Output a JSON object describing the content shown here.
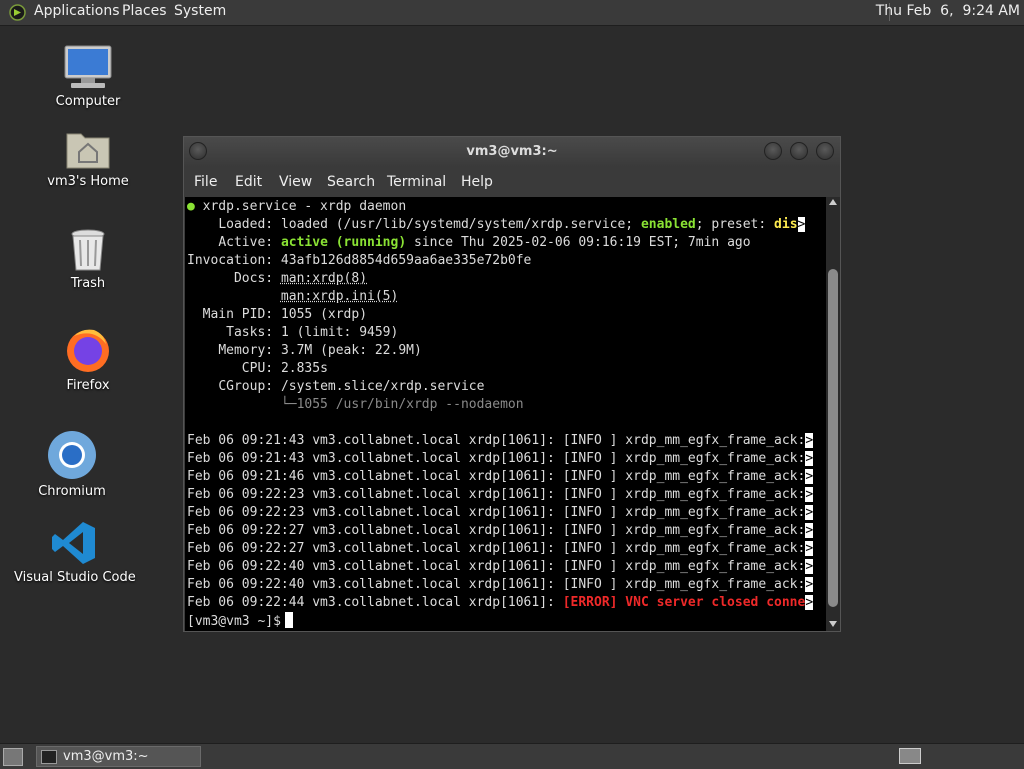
{
  "top_panel": {
    "menus": [
      "Applications",
      "Places",
      "System"
    ],
    "clock": "Thu Feb  6,  9:24 AM"
  },
  "desktop_icons": [
    {
      "label": "Computer",
      "icon": "computer-icon"
    },
    {
      "label": "vm3's Home",
      "icon": "home-folder-icon"
    },
    {
      "label": "Trash",
      "icon": "trash-icon"
    },
    {
      "label": "Firefox",
      "icon": "firefox-icon"
    },
    {
      "label": "Chromium",
      "icon": "chromium-icon"
    },
    {
      "label": "Visual Studio Code",
      "icon": "vscode-icon"
    }
  ],
  "terminal": {
    "title": "vm3@vm3:~",
    "menu": [
      "File",
      "Edit",
      "View",
      "Search",
      "Terminal",
      "Help"
    ],
    "status": {
      "header_unit": "xrdp.service - xrdp daemon",
      "loaded_label": "Loaded:",
      "loaded_pre": "loaded (/usr/lib/systemd/system/xrdp.service; ",
      "loaded_enabled": "enabled",
      "loaded_mid": "; preset: ",
      "loaded_preset": "dis",
      "active_label": "Active:",
      "active_state": "active (running)",
      "active_rest": " since Thu 2025-02-06 09:16:19 EST; 7min ago",
      "invocation_label": "Invocation:",
      "invocation_value": "43afb126d8854d659aa6ae335e72b0fe",
      "docs_label": "Docs:",
      "docs_1": "man:xrdp(8)",
      "docs_2": "man:xrdp.ini(5)",
      "mainpid_label": "Main PID:",
      "mainpid_value": "1055 (xrdp)",
      "tasks_label": "Tasks:",
      "tasks_value": "1 (limit: 9459)",
      "memory_label": "Memory:",
      "memory_value": "3.7M (peak: 22.9M)",
      "cpu_label": "CPU:",
      "cpu_value": "2.835s",
      "cgroup_label": "CGroup:",
      "cgroup_value": "/system.slice/xrdp.service",
      "cgroup_child": "1055 /usr/bin/xrdp --nodaemon"
    },
    "log_lines": [
      {
        "prefix": "Feb 06 09:21:43 vm3.collabnet.local xrdp[1061]: ",
        "level": "[INFO ]",
        "msg": " xrdp_mm_egfx_frame_ack:"
      },
      {
        "prefix": "Feb 06 09:21:43 vm3.collabnet.local xrdp[1061]: ",
        "level": "[INFO ]",
        "msg": " xrdp_mm_egfx_frame_ack:"
      },
      {
        "prefix": "Feb 06 09:21:46 vm3.collabnet.local xrdp[1061]: ",
        "level": "[INFO ]",
        "msg": " xrdp_mm_egfx_frame_ack:"
      },
      {
        "prefix": "Feb 06 09:22:23 vm3.collabnet.local xrdp[1061]: ",
        "level": "[INFO ]",
        "msg": " xrdp_mm_egfx_frame_ack:"
      },
      {
        "prefix": "Feb 06 09:22:23 vm3.collabnet.local xrdp[1061]: ",
        "level": "[INFO ]",
        "msg": " xrdp_mm_egfx_frame_ack:"
      },
      {
        "prefix": "Feb 06 09:22:27 vm3.collabnet.local xrdp[1061]: ",
        "level": "[INFO ]",
        "msg": " xrdp_mm_egfx_frame_ack:"
      },
      {
        "prefix": "Feb 06 09:22:27 vm3.collabnet.local xrdp[1061]: ",
        "level": "[INFO ]",
        "msg": " xrdp_mm_egfx_frame_ack:"
      },
      {
        "prefix": "Feb 06 09:22:40 vm3.collabnet.local xrdp[1061]: ",
        "level": "[INFO ]",
        "msg": " xrdp_mm_egfx_frame_ack:"
      },
      {
        "prefix": "Feb 06 09:22:40 vm3.collabnet.local xrdp[1061]: ",
        "level": "[INFO ]",
        "msg": " xrdp_mm_egfx_frame_ack:"
      },
      {
        "prefix": "Feb 06 09:22:44 vm3.collabnet.local xrdp[1061]: ",
        "level": "[ERROR]",
        "msg": " VNC server closed conne"
      }
    ],
    "truncation_marker": ">",
    "prompt": "[vm3@vm3 ~]$"
  },
  "bottom_panel": {
    "task_label": "vm3@vm3:~"
  }
}
